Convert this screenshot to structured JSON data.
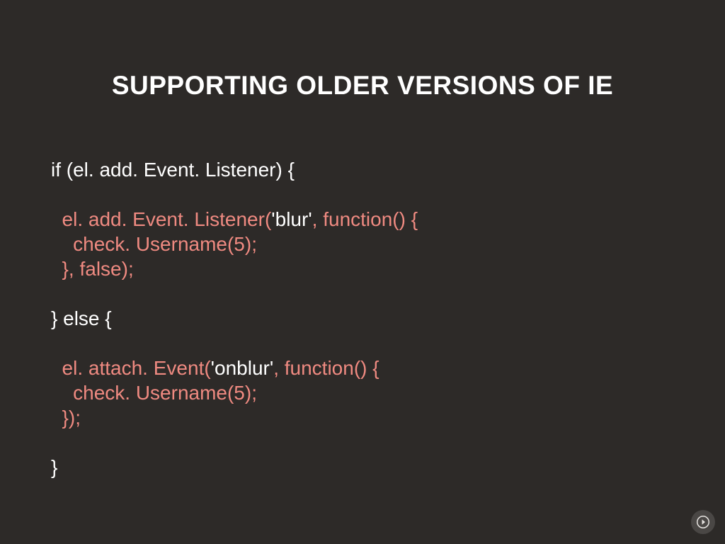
{
  "title": "SUPPORTING OLDER VERSIONS OF IE",
  "code": {
    "l1": "if (el. add. Event. Listener) {",
    "l2a": "  el. add. Event. Listener(",
    "l2b": "'blur'",
    "l2c": ", function() {",
    "l3": "    check. Username(5);",
    "l4": "  }, false);",
    "l5": "} else {",
    "l6a": "  el. attach. Event(",
    "l6b": "'onblur'",
    "l6c": ", function() {",
    "l7": "    check. Username(5);",
    "l8": "  });",
    "l9": "}"
  },
  "nav": {
    "next": "next-slide"
  }
}
